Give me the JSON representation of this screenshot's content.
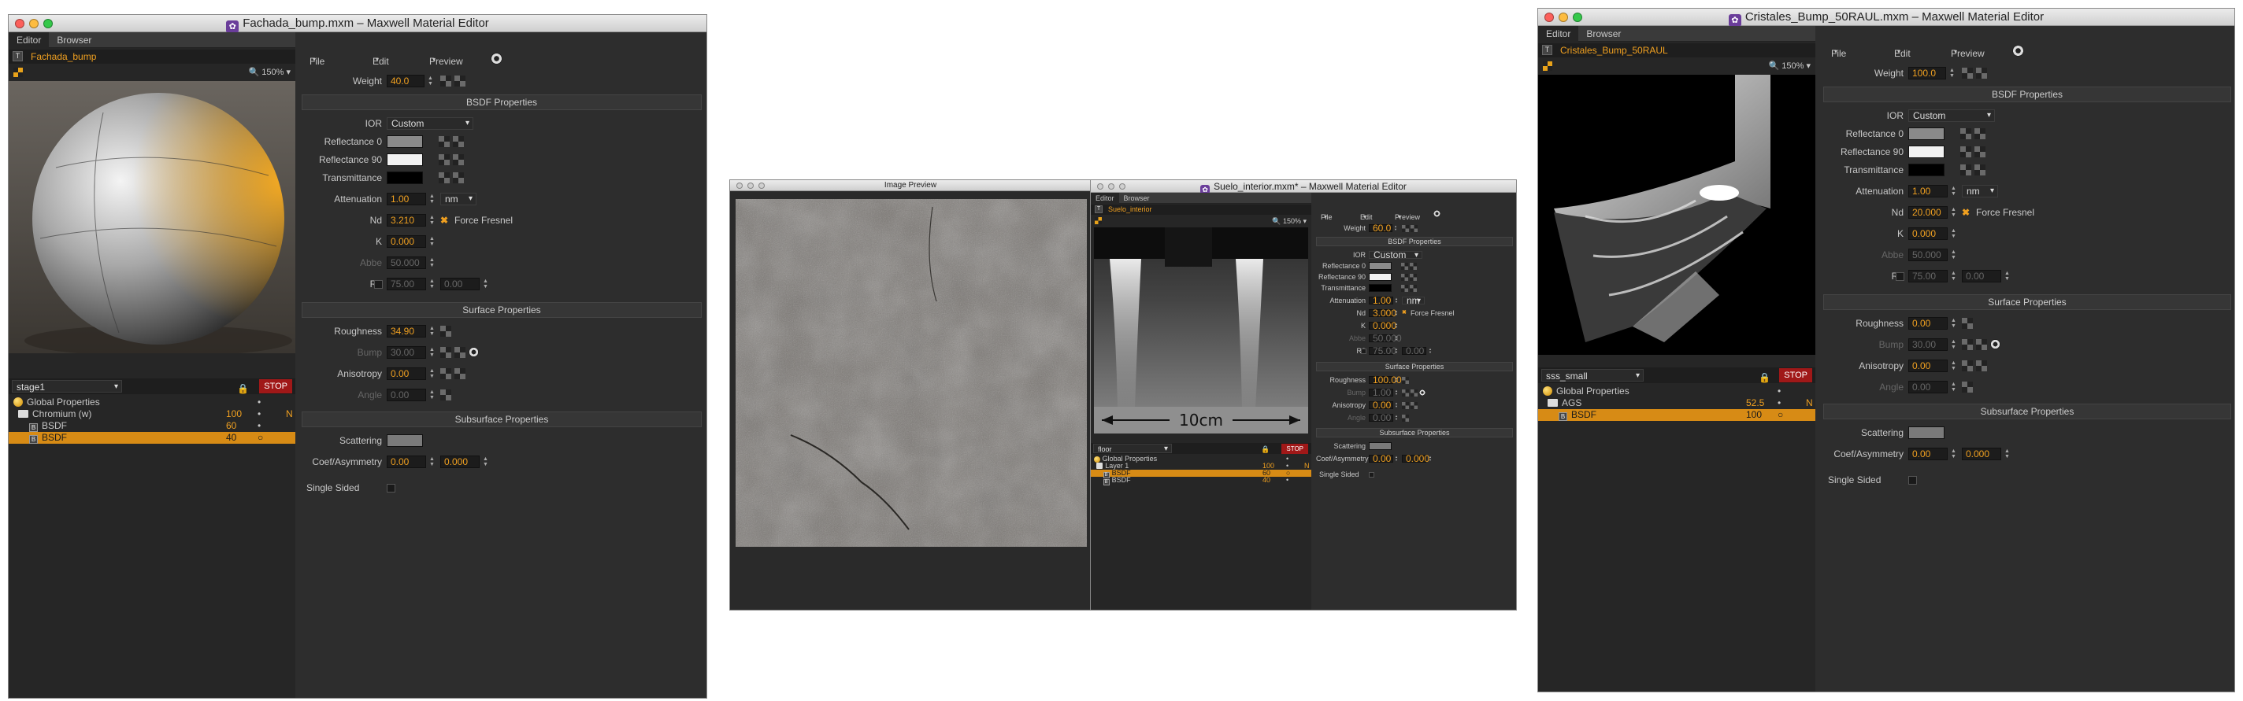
{
  "win1": {
    "title": "Fachada_bump.mxm – Maxwell Material Editor",
    "tabs": [
      "Editor",
      "Browser"
    ],
    "material_name": "Fachada_bump",
    "zoom": "150%",
    "stage": "stage1",
    "stop": "STOP",
    "tree": [
      {
        "name": "Global Properties",
        "icon": "sun-icon",
        "c2": "",
        "c3": "•",
        "c4": ""
      },
      {
        "name": "Chromium (w)",
        "icon": "folder-icon",
        "c2": "100",
        "c3": "•",
        "c4": "N"
      },
      {
        "name": "BSDF",
        "icon": "bsdf-icon",
        "c2": "60",
        "c3": "•",
        "c4": ""
      },
      {
        "name": "BSDF",
        "icon": "bsdf-icon",
        "c2": "40",
        "c3": "○",
        "c4": ""
      }
    ],
    "menu": [
      "File",
      "Edit",
      "Preview"
    ],
    "weight_label": "Weight",
    "weight": "40.0",
    "bsdf_header": "BSDF Properties",
    "ior_label": "IOR",
    "ior": "Custom",
    "refl0_label": "Reflectance 0",
    "refl90_label": "Reflectance 90",
    "trans_label": "Transmittance",
    "att_label": "Attenuation",
    "att": "1.00",
    "att_unit": "nm",
    "nd_label": "Nd",
    "nd": "3.210",
    "fresnel_label": "Force Fresnel",
    "k_label": "K",
    "k": "0.000",
    "abbe_label": "Abbe",
    "abbe": "50.000",
    "r2_label": "R2",
    "r2a": "75.00",
    "r2b": "0.00",
    "surface_header": "Surface Properties",
    "rough_label": "Roughness",
    "rough": "34.90",
    "bump_label": "Bump",
    "bump": "30.00",
    "aniso_label": "Anisotropy",
    "aniso": "0.00",
    "angle_label": "Angle",
    "angle": "0.00",
    "sub_header": "Subsurface Properties",
    "scat_label": "Scattering",
    "coef_label": "Coef/Asymmetry",
    "coef": "0.00",
    "asym": "0.000",
    "single_label": "Single Sided"
  },
  "preview": {
    "title": "Image Preview"
  },
  "win2": {
    "title": "Suelo_interior.mxm* – Maxwell Material Editor",
    "tabs": [
      "Editor",
      "Browser"
    ],
    "material_name": "Suelo_interior",
    "zoom": "150%",
    "scale_label": "10cm",
    "stage": "floor",
    "stop": "STOP",
    "tree": [
      {
        "name": "Global Properties",
        "icon": "sun-icon",
        "c2": "",
        "c3": "•",
        "c4": ""
      },
      {
        "name": "Layer 1",
        "icon": "folder-icon",
        "c2": "100",
        "c3": "•",
        "c4": "N"
      },
      {
        "name": "BSDF",
        "icon": "bsdf-icon",
        "c2": "60",
        "c3": "○",
        "c4": ""
      },
      {
        "name": "BSDF",
        "icon": "bsdf-icon",
        "c2": "40",
        "c3": "•",
        "c4": ""
      }
    ],
    "menu": [
      "File",
      "Edit",
      "Preview"
    ],
    "weight_label": "Weight",
    "weight": "60.0",
    "bsdf_header": "BSDF Properties",
    "ior_label": "IOR",
    "ior": "Custom",
    "refl0_label": "Reflectance 0",
    "refl90_label": "Reflectance 90",
    "trans_label": "Transmittance",
    "att_label": "Attenuation",
    "att": "1.00",
    "att_unit": "nm",
    "nd_label": "Nd",
    "nd": "3.000",
    "fresnel_label": "Force Fresnel",
    "k_label": "K",
    "k": "0.000",
    "abbe_label": "Abbe",
    "abbe": "50.000",
    "r2_label": "R2",
    "r2a": "75.00",
    "r2b": "0.00",
    "surface_header": "Surface Properties",
    "rough_label": "Roughness",
    "rough": "100.00",
    "bump_label": "Bump",
    "bump": "1.00",
    "aniso_label": "Anisotropy",
    "aniso": "0.00",
    "angle_label": "Angle",
    "angle": "0.00",
    "sub_header": "Subsurface Properties",
    "scat_label": "Scattering",
    "coef_label": "Coef/Asymmetry",
    "coef": "0.00",
    "asym": "0.000",
    "single_label": "Single Sided"
  },
  "win3": {
    "title": "Cristales_Bump_50RAUL.mxm – Maxwell Material Editor",
    "tabs": [
      "Editor",
      "Browser"
    ],
    "material_name": "Cristales_Bump_50RAUL",
    "zoom": "150%",
    "stage": "sss_small",
    "stop": "STOP",
    "tree": [
      {
        "name": "Global Properties",
        "icon": "sun-icon",
        "c2": "",
        "c3": "•",
        "c4": ""
      },
      {
        "name": "AGS",
        "icon": "folder-icon",
        "c2": "52.5",
        "c3": "•",
        "c4": "N"
      },
      {
        "name": "BSDF",
        "icon": "bsdf-icon",
        "c2": "100",
        "c3": "○",
        "c4": ""
      }
    ],
    "menu": [
      "File",
      "Edit",
      "Preview"
    ],
    "weight_label": "Weight",
    "weight": "100.0",
    "bsdf_header": "BSDF Properties",
    "ior_label": "IOR",
    "ior": "Custom",
    "refl0_label": "Reflectance 0",
    "refl90_label": "Reflectance 90",
    "trans_label": "Transmittance",
    "att_label": "Attenuation",
    "att": "1.00",
    "att_unit": "nm",
    "nd_label": "Nd",
    "nd": "20.000",
    "fresnel_label": "Force Fresnel",
    "k_label": "K",
    "k": "0.000",
    "abbe_label": "Abbe",
    "abbe": "50.000",
    "r2_label": "R2",
    "r2a": "75.00",
    "r2b": "0.00",
    "surface_header": "Surface Properties",
    "rough_label": "Roughness",
    "rough": "0.00",
    "bump_label": "Bump",
    "bump": "30.00",
    "aniso_label": "Anisotropy",
    "aniso": "0.00",
    "angle_label": "Angle",
    "angle": "0.00",
    "sub_header": "Subsurface Properties",
    "scat_label": "Scattering",
    "coef_label": "Coef/Asymmetry",
    "coef": "0.00",
    "asym": "0.000",
    "single_label": "Single Sided"
  },
  "colors": {
    "accent": "#f0a020",
    "selection": "#d78b15",
    "stop": "#a01818",
    "panel": "#2d2d2d"
  }
}
